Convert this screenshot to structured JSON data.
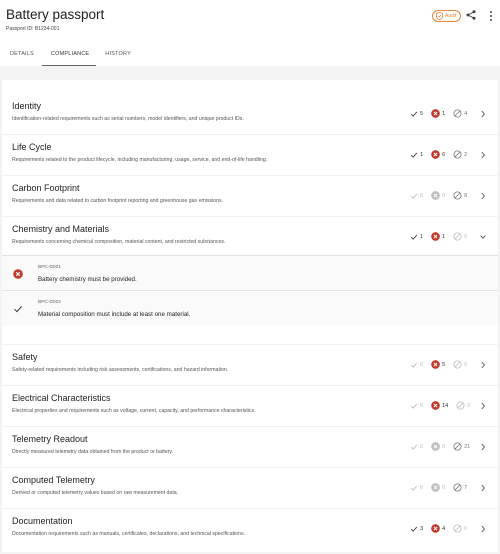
{
  "header": {
    "title": "Battery passport",
    "passport_id": "Passport ID: B1234-001",
    "audit_label": "Audit"
  },
  "tabs": [
    "DETAILS",
    "COMPLIANCE",
    "HISTORY"
  ],
  "active_tab": "COMPLIANCE",
  "sections": [
    {
      "title": "Identity",
      "desc": "Identification-related requirements such as serial numbers, model identifiers, and unique product IDs.",
      "pass": "5",
      "fail": "1",
      "na": "4",
      "pass_active": true,
      "fail_active": true,
      "na_active": true,
      "expanded": false
    },
    {
      "title": "Life Cycle",
      "desc": "Requirements related to the product lifecycle, including manufacturing, usage, service, and end-of-life handling.",
      "pass": "1",
      "fail": "6",
      "na": "2",
      "pass_active": true,
      "fail_active": true,
      "na_active": true,
      "expanded": false
    },
    {
      "title": "Carbon Footprint",
      "desc": "Requirements and data related to carbon footprint reporting and greenhouse gas emissions.",
      "pass": "0",
      "fail": "0",
      "na": "8",
      "pass_active": false,
      "fail_active": false,
      "na_active": true,
      "expanded": false
    },
    {
      "title": "Chemistry and Materials",
      "desc": "Requirements concerning chemical composition, material content, and restricted substances.",
      "pass": "1",
      "fail": "1",
      "na": "0",
      "pass_active": true,
      "fail_active": true,
      "na_active": false,
      "expanded": true
    },
    {
      "title": "Safety",
      "desc": "Safety-related requirements including risk assessments, certifications, and hazard information.",
      "pass": "0",
      "fail": "5",
      "na": "0",
      "pass_active": false,
      "fail_active": true,
      "na_active": false,
      "expanded": false
    },
    {
      "title": "Electrical Characteristics",
      "desc": "Electrical properties and requirements such as voltage, current, capacity, and performance characteristics.",
      "pass": "0",
      "fail": "14",
      "na": "0",
      "pass_active": false,
      "fail_active": true,
      "na_active": false,
      "expanded": false
    },
    {
      "title": "Telemetry Readout",
      "desc": "Directly measured telemetry data obtained from the product or battery.",
      "pass": "0",
      "fail": "0",
      "na": "21",
      "pass_active": false,
      "fail_active": false,
      "na_active": true,
      "expanded": false
    },
    {
      "title": "Computed Telemetry",
      "desc": "Derived or computed telemetry values based on raw measurement data.",
      "pass": "0",
      "fail": "0",
      "na": "7",
      "pass_active": false,
      "fail_active": false,
      "na_active": true,
      "expanded": false
    },
    {
      "title": "Documentation",
      "desc": "Documentation requirements such as manuals, certificates, declarations, and technical specifications.",
      "pass": "3",
      "fail": "4",
      "na": "0",
      "pass_active": true,
      "fail_active": true,
      "na_active": false,
      "expanded": false
    }
  ],
  "requirements": [
    {
      "code": "BPC-D001",
      "text": "Battery chemistry must be provided.",
      "status": "fail"
    },
    {
      "code": "BPC-D002",
      "text": "Material composition must include at least one material.",
      "status": "pass"
    }
  ],
  "colors": {
    "fail": "#c0392b",
    "audit": "#e6853a",
    "pass": "#444444",
    "muted": "#bdbdbd"
  }
}
